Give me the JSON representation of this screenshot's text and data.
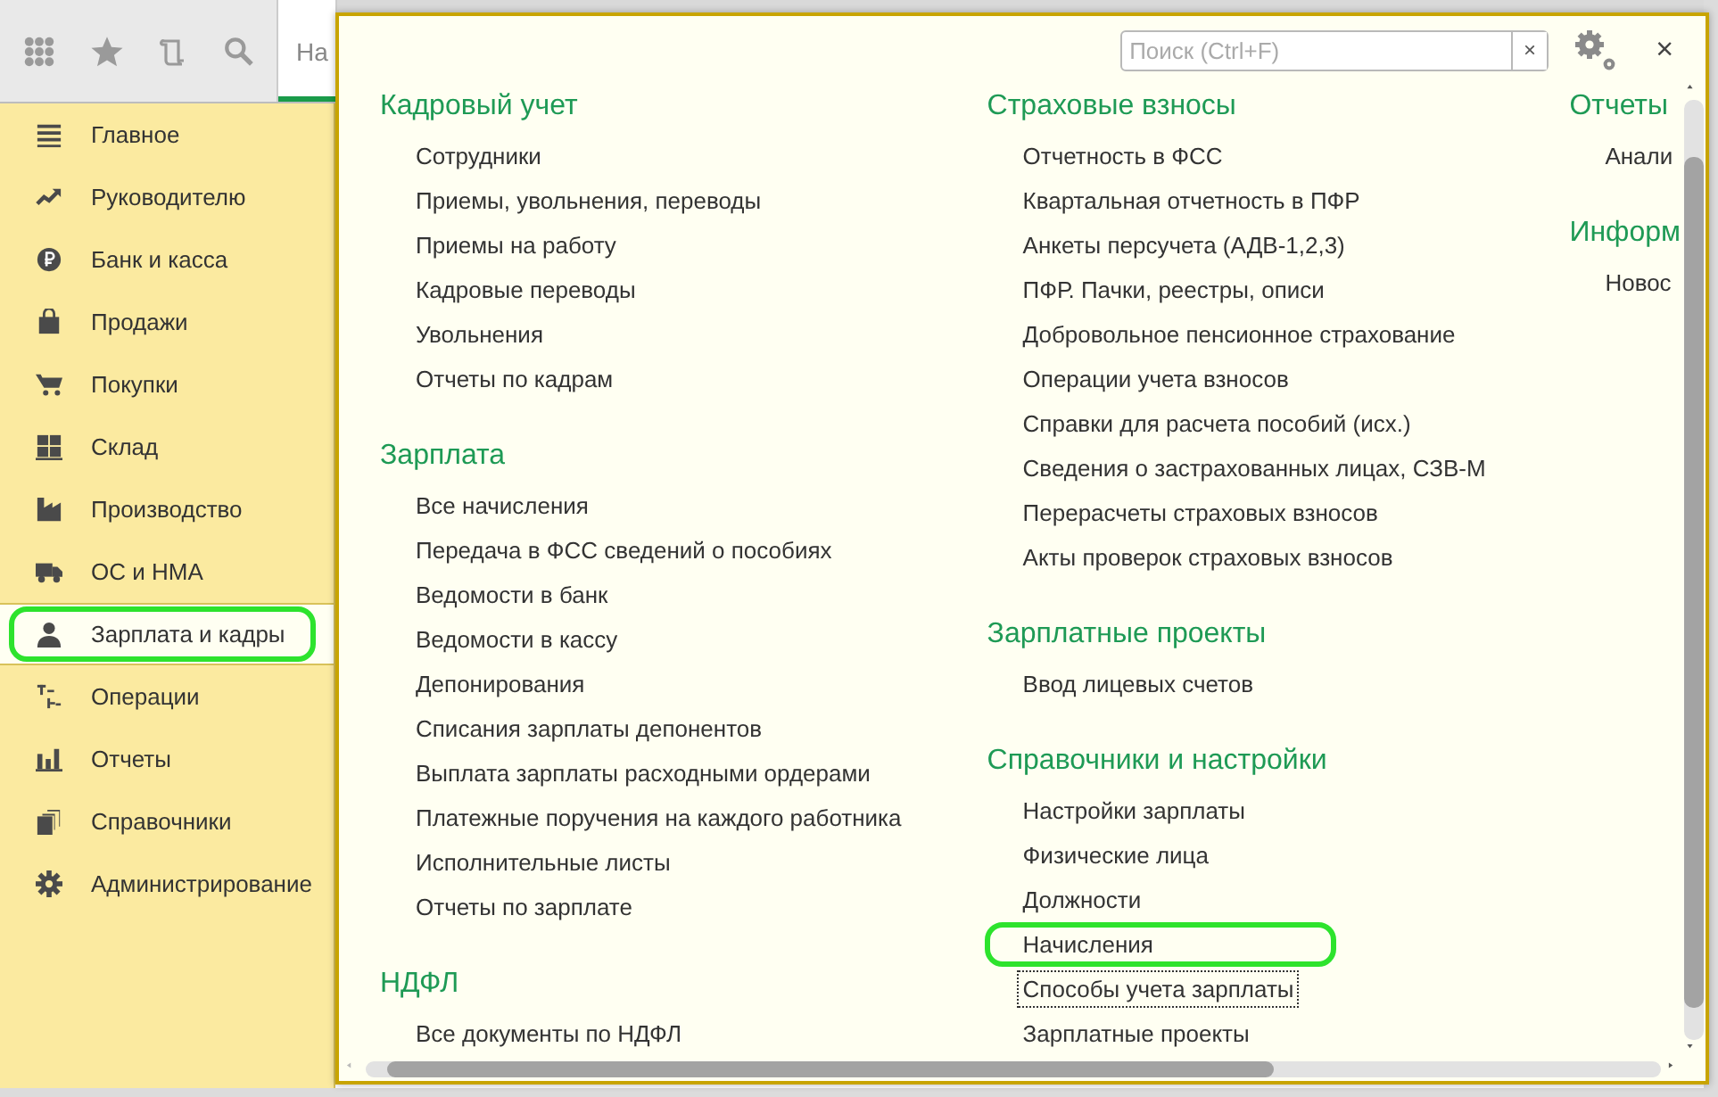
{
  "toolbar": {
    "tab": {
      "label": "На",
      "selected": true
    }
  },
  "sidebar": {
    "items": [
      {
        "label": "Главное",
        "kind": "menu",
        "selected": false
      },
      {
        "label": "Руководителю",
        "kind": "trend",
        "selected": false
      },
      {
        "label": "Банк и касса",
        "kind": "ruble",
        "selected": false
      },
      {
        "label": "Продажи",
        "kind": "bag",
        "selected": false
      },
      {
        "label": "Покупки",
        "kind": "cart",
        "selected": false
      },
      {
        "label": "Склад",
        "kind": "grid",
        "selected": false
      },
      {
        "label": "Производство",
        "kind": "factory",
        "selected": false
      },
      {
        "label": "ОС и НМА",
        "kind": "truck",
        "selected": false
      },
      {
        "label": "Зарплата и кадры",
        "kind": "person",
        "selected": true
      },
      {
        "label": "Операции",
        "kind": "ledger",
        "selected": false
      },
      {
        "label": "Отчеты",
        "kind": "bars",
        "selected": false
      },
      {
        "label": "Справочники",
        "kind": "docs",
        "selected": false
      },
      {
        "label": "Администрирование",
        "kind": "gear",
        "selected": false
      }
    ]
  },
  "panel": {
    "search": {
      "placeholder": "Поиск (Ctrl+F)"
    },
    "clear_button": "×",
    "close_button": "×",
    "columns": [
      {
        "sections": [
          {
            "title": "Кадровый учет",
            "items": [
              {
                "label": "Сотрудники",
                "highlighted": false,
                "focused": false
              },
              {
                "label": "Приемы, увольнения, переводы",
                "highlighted": false,
                "focused": false
              },
              {
                "label": "Приемы на работу",
                "highlighted": false,
                "focused": false
              },
              {
                "label": "Кадровые переводы",
                "highlighted": false,
                "focused": false
              },
              {
                "label": "Увольнения",
                "highlighted": false,
                "focused": false
              },
              {
                "label": "Отчеты по кадрам",
                "highlighted": false,
                "focused": false
              }
            ]
          },
          {
            "title": "Зарплата",
            "items": [
              {
                "label": "Все начисления",
                "highlighted": false,
                "focused": false
              },
              {
                "label": "Передача в ФСС сведений о пособиях",
                "highlighted": false,
                "focused": false
              },
              {
                "label": "Ведомости в банк",
                "highlighted": false,
                "focused": false
              },
              {
                "label": "Ведомости в кассу",
                "highlighted": false,
                "focused": false
              },
              {
                "label": "Депонирования",
                "highlighted": false,
                "focused": false
              },
              {
                "label": "Списания зарплаты депонентов",
                "highlighted": false,
                "focused": false
              },
              {
                "label": "Выплата зарплаты расходными ордерами",
                "highlighted": false,
                "focused": false
              },
              {
                "label": "Платежные поручения на каждого работника",
                "highlighted": false,
                "focused": false
              },
              {
                "label": "Исполнительные листы",
                "highlighted": false,
                "focused": false
              },
              {
                "label": "Отчеты по зарплате",
                "highlighted": false,
                "focused": false
              }
            ]
          },
          {
            "title": "НДФЛ",
            "items": [
              {
                "label": "Все документы по НДФЛ",
                "highlighted": false,
                "focused": false
              }
            ]
          }
        ]
      },
      {
        "sections": [
          {
            "title": "Страховые взносы",
            "items": [
              {
                "label": "Отчетность в ФСС",
                "highlighted": false,
                "focused": false
              },
              {
                "label": "Квартальная отчетность в ПФР",
                "highlighted": false,
                "focused": false
              },
              {
                "label": "Анкеты персучета (АДВ-1,2,3)",
                "highlighted": false,
                "focused": false
              },
              {
                "label": "ПФР. Пачки, реестры, описи",
                "highlighted": false,
                "focused": false
              },
              {
                "label": "Добровольное пенсионное страхование",
                "highlighted": false,
                "focused": false
              },
              {
                "label": "Операции учета взносов",
                "highlighted": false,
                "focused": false
              },
              {
                "label": "Справки для расчета пособий (исх.)",
                "highlighted": false,
                "focused": false
              },
              {
                "label": "Сведения о застрахованных лицах, СЗВ-М",
                "highlighted": false,
                "focused": false
              },
              {
                "label": "Перерасчеты страховых взносов",
                "highlighted": false,
                "focused": false
              },
              {
                "label": "Акты проверок страховых взносов",
                "highlighted": false,
                "focused": false
              }
            ]
          },
          {
            "title": "Зарплатные проекты",
            "items": [
              {
                "label": "Ввод лицевых счетов",
                "highlighted": false,
                "focused": false
              }
            ]
          },
          {
            "title": "Справочники и настройки",
            "items": [
              {
                "label": "Настройки зарплаты",
                "highlighted": false,
                "focused": false
              },
              {
                "label": "Физические лица",
                "highlighted": false,
                "focused": false
              },
              {
                "label": "Должности",
                "highlighted": false,
                "focused": false
              },
              {
                "label": "Начисления",
                "highlighted": true,
                "focused": false
              },
              {
                "label": "Способы учета зарплаты",
                "highlighted": false,
                "focused": true
              },
              {
                "label": "Зарплатные проекты",
                "highlighted": false,
                "focused": false
              }
            ]
          }
        ]
      },
      {
        "sections": [
          {
            "title": "Отчеты",
            "items": [
              {
                "label": "Анали",
                "highlighted": false,
                "focused": false
              }
            ]
          },
          {
            "title": "Информ",
            "items": [
              {
                "label": "Новос",
                "highlighted": false,
                "focused": false
              }
            ]
          }
        ]
      }
    ]
  }
}
